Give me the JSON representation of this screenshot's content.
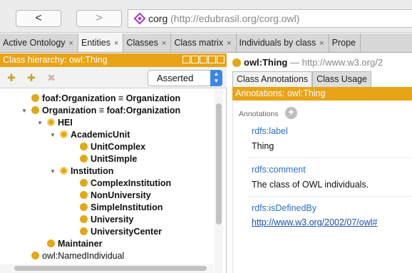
{
  "nav": {
    "back_label": "<",
    "forward_label": ">"
  },
  "address": {
    "name": "corg",
    "url": "(http://edubrasil.org/corg.owl)",
    "icon": "ontology-diamond-icon"
  },
  "tabs": [
    {
      "label": "Active Ontology",
      "close": "×"
    },
    {
      "label": "Entities",
      "close": "×"
    },
    {
      "label": "Classes",
      "close": "×"
    },
    {
      "label": "Class matrix",
      "close": "×"
    },
    {
      "label": "Individuals by class",
      "close": "×"
    },
    {
      "label": "Prope",
      "close": ""
    }
  ],
  "left": {
    "header": "Class hierarchy: owl:Thing",
    "select_value": "Asserted",
    "tree": [
      {
        "label": "foaf:Organization ≡ Organization",
        "twisty": "",
        "bold": true
      },
      {
        "label": "Organization ≡ foaf:Organization",
        "twisty": "▼",
        "bold": true
      },
      {
        "label": "HEI",
        "twisty": "▼",
        "bold": true
      },
      {
        "label": "AcademicUnit",
        "twisty": "▼",
        "bold": true
      },
      {
        "label": "UnitComplex",
        "twisty": "",
        "bold": true
      },
      {
        "label": "UnitSimple",
        "twisty": "",
        "bold": true
      },
      {
        "label": "Institution",
        "twisty": "▼",
        "bold": true
      },
      {
        "label": "ComplexInstitution",
        "twisty": "",
        "bold": true
      },
      {
        "label": "NonUniversity",
        "twisty": "",
        "bold": true
      },
      {
        "label": "SimpleInstitution",
        "twisty": "",
        "bold": true
      },
      {
        "label": "University",
        "twisty": "",
        "bold": true
      },
      {
        "label": "UniversityCenter",
        "twisty": "",
        "bold": true
      },
      {
        "label": "Maintainer",
        "twisty": "",
        "bold": true
      },
      {
        "label": "owl:NamedIndividual",
        "twisty": "",
        "bold": false
      }
    ]
  },
  "right": {
    "entity_name": "owl:Thing",
    "entity_iri": "— http://www.w3.org/2",
    "tabs": [
      "Class Annotations",
      "Class Usage"
    ],
    "ann_header": "Annotations: owl:Thing",
    "ann_label": "Annotations",
    "annotations": [
      {
        "property": "rdfs:label",
        "value": "Thing",
        "is_link": false
      },
      {
        "property": "rdfs:comment",
        "value": "The class of OWL individuals.",
        "is_link": false
      },
      {
        "property": "rdfs:isDefinedBy",
        "value": "http://www.w3.org/2002/07/owl#",
        "is_link": true
      }
    ]
  },
  "colors": {
    "accent": "#e8a317",
    "class_dot": "#e3a816",
    "link": "#2b6fc9",
    "select_arrow": "#3d86e6"
  }
}
